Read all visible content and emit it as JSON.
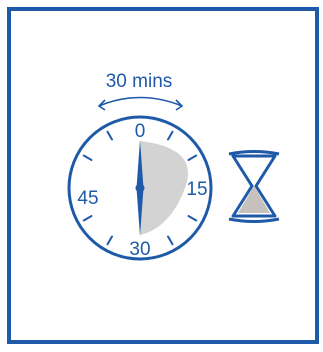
{
  "colors": {
    "frame": "#1E5AA7",
    "line": "#1E5AA7",
    "shade": "#D3D3D3",
    "sand": "#C7C1BE",
    "background": "#FFFFFF"
  },
  "timer": {
    "duration_label": "30 mins",
    "label_0": "0",
    "label_15": "15",
    "label_30": "30",
    "label_45": "45",
    "elapsed_fraction": 0.5
  },
  "icons": [
    "clock-icon",
    "hourglass-icon"
  ]
}
